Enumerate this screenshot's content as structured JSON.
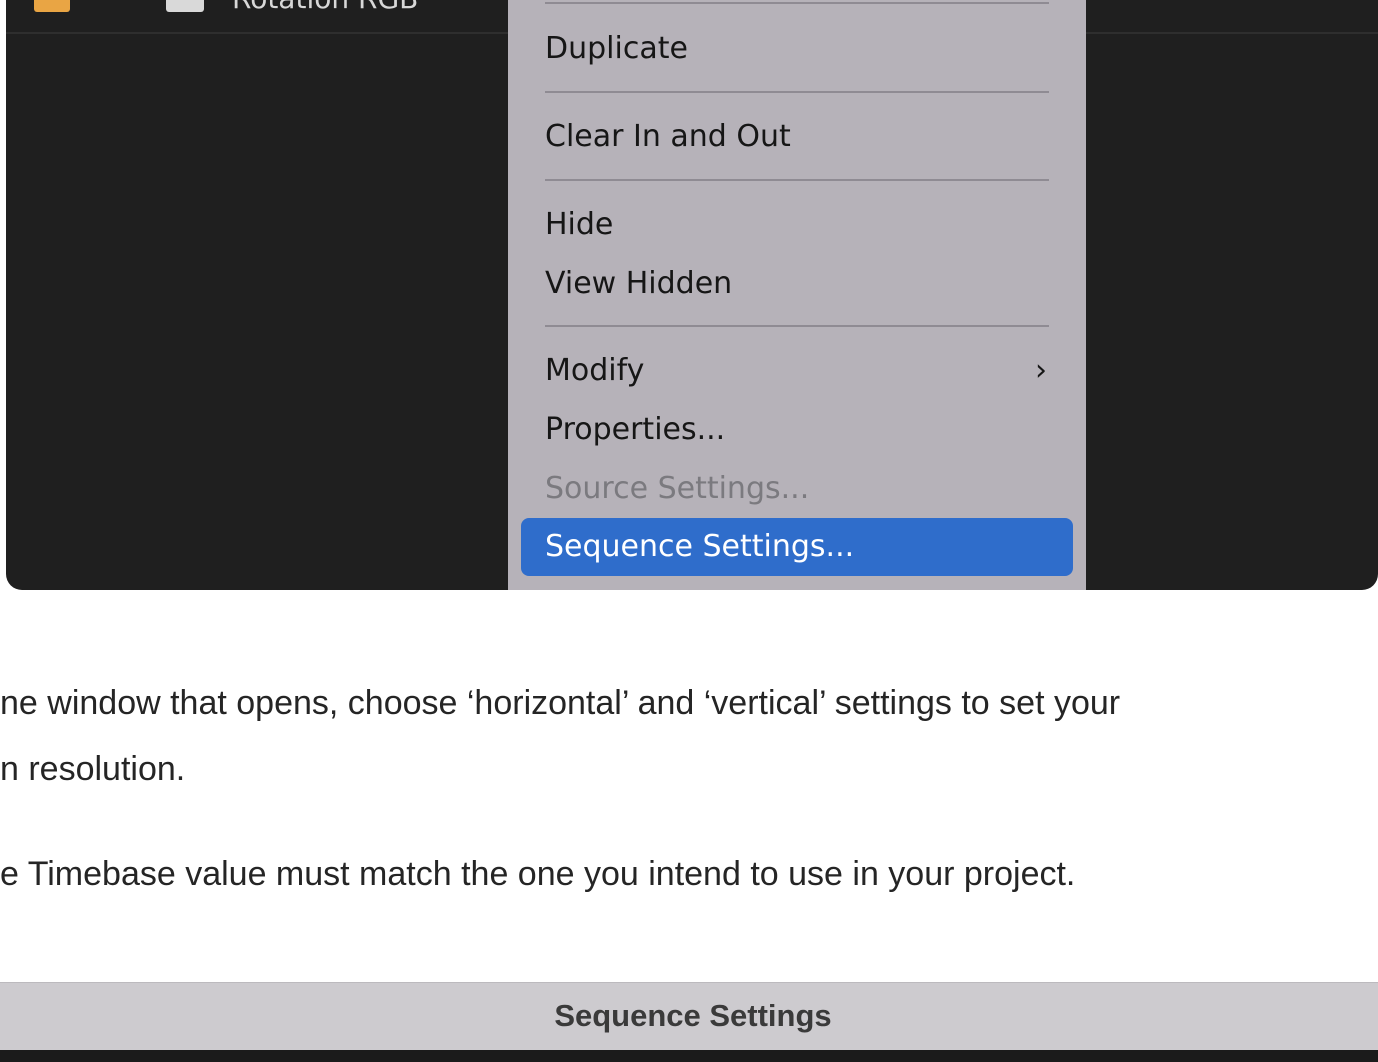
{
  "panel": {
    "item_name": "Rotation RGB",
    "disclosure_glyph": "›",
    "label_color": "#e9a544"
  },
  "context_menu": {
    "items": [
      {
        "label": "Duplicate",
        "enabled": true
      },
      {
        "label": "Clear In and Out",
        "enabled": true
      },
      {
        "label": "Hide",
        "enabled": true
      },
      {
        "label": "View Hidden",
        "enabled": true
      },
      {
        "label": "Modify",
        "enabled": true,
        "has_submenu": true,
        "submenu_glyph": "›"
      },
      {
        "label": "Properties...",
        "enabled": true
      },
      {
        "label": "Source Settings...",
        "enabled": false
      },
      {
        "label": "Sequence Settings...",
        "enabled": true,
        "selected": true
      }
    ],
    "highlight_color": "#2f6dcb"
  },
  "article": {
    "line1": "ne window that opens, choose ‘horizontal’ and ‘vertical’ settings to set your",
    "line2": "n resolution.",
    "line3": "e Timebase value must match the one you intend to use in your project."
  },
  "dialog": {
    "title": "Sequence Settings"
  }
}
